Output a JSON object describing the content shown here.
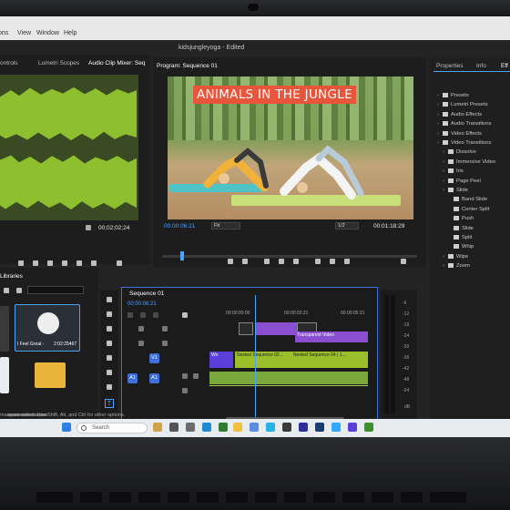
{
  "window": {
    "title": "kidsjungleyoga - Edited",
    "menu": [
      "View",
      "Window",
      "Help"
    ],
    "menu_partial_left": "ons"
  },
  "audio_panel": {
    "tabs": [
      "ontrols",
      "Lumetri Scopes",
      "Audio Clip Mixer: Seq"
    ],
    "timecode": "00;02;02;24"
  },
  "program_monitor": {
    "tab": "Program: Sequence 01",
    "video_title": "ANIMALS IN THE JUNGLE",
    "timecode_current": "00:00:06:21",
    "fit": "Fit",
    "resolution": "1/2",
    "timecode_duration": "00:01:18:29"
  },
  "effects_panel": {
    "tabs": [
      "Properties",
      "Info",
      "Eff"
    ],
    "items": [
      {
        "label": "Presets",
        "level": 0
      },
      {
        "label": "Lumetri Presets",
        "level": 0
      },
      {
        "label": "Audio Effects",
        "level": 0
      },
      {
        "label": "Audio Transitions",
        "level": 0
      },
      {
        "label": "Video Effects",
        "level": 0
      },
      {
        "label": "Video Transitions",
        "level": 0
      },
      {
        "label": "Dissolve",
        "level": 1
      },
      {
        "label": "Immersive Video",
        "level": 1
      },
      {
        "label": "Iris",
        "level": 1
      },
      {
        "label": "Page Peel",
        "level": 1
      },
      {
        "label": "Slide",
        "level": 1
      },
      {
        "label": "Band Slide",
        "level": 2
      },
      {
        "label": "Center Split",
        "level": 2
      },
      {
        "label": "Push",
        "level": 2
      },
      {
        "label": "Slide",
        "level": 2
      },
      {
        "label": "Split",
        "level": 2
      },
      {
        "label": "Whip",
        "level": 2
      },
      {
        "label": "Wipe",
        "level": 1
      },
      {
        "label": "Zoom",
        "level": 1
      }
    ]
  },
  "libraries_panel": {
    "tab": "Libraries",
    "item_label": "I Feel Great -",
    "item_duration": "2:02:25467"
  },
  "timeline": {
    "tab": "Sequence 01",
    "timecode": "00:00:06:21",
    "ruler": [
      "00:00:00:00",
      "00:00:02:21",
      "00:00:05:21"
    ],
    "tracks": {
      "v1": "V1",
      "a1": "A1",
      "a1_left": "A1"
    },
    "clips": {
      "transparent_video": "Transparent Video",
      "nested_a": "Nested Sequence 02...",
      "nested_b": "Nested Sequence 04 | 1...",
      "wo": "Wo"
    }
  },
  "meters": {
    "scale": [
      "-6",
      "-12",
      "-18",
      "-24",
      "-30",
      "-36",
      "-42",
      "-48",
      "-54"
    ],
    "bottom": "dB"
  },
  "status_bar": {
    "text": "marquee select. Use Shift, Alt, and Ctrl for other options."
  },
  "taskbar": {
    "search_placeholder": "Search"
  },
  "colors": {
    "accent": "#4aa3ff",
    "waveform": "#8dbf2e",
    "clip_purple": "#8a4fd1",
    "clip_green": "#9bbf2a",
    "title_red": "#e8553a"
  }
}
